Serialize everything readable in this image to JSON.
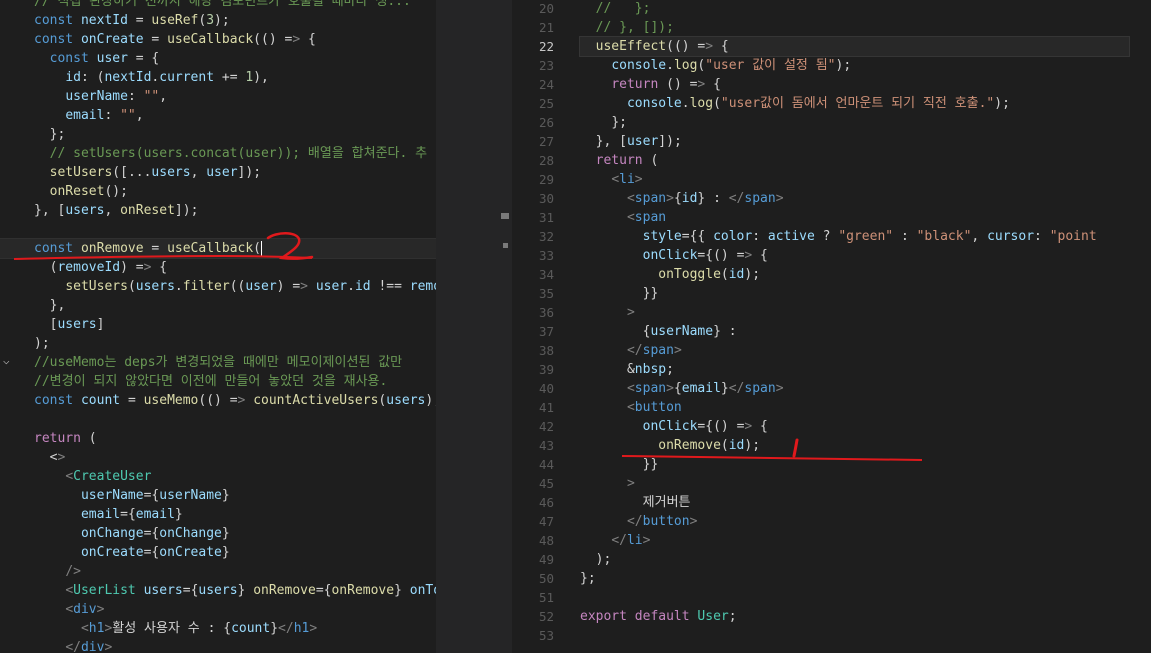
{
  "left_editor": {
    "lines": [
      "// 직접 관장하기 전까지 해당 컴포넌트가 호출될 때마다 생...",
      "const nextId = useRef(3);",
      "const onCreate = useCallback(() => {",
      "  const user = {",
      "    id: (nextId.current += 1),",
      "    userName: \"\",",
      "    email: \"\",",
      "  };",
      "  // setUsers(users.concat(user)); 배열을 합쳐준다. 추",
      "  setUsers([...users, user]);",
      "  onReset();",
      "}, [users, onReset]);",
      "",
      "const onRemove = useCallback(",
      "  (removeId) => {",
      "    setUsers(users.filter((user) => user.id !== remov",
      "  },",
      "  [users]",
      ");",
      "//useMemo는 deps가 변경되었을 때에만 메모이제이션된 값만",
      "//변경이 되지 않았다면 이전에 만들어 놓았던 것을 재사용.",
      "const count = useMemo(() => countActiveUsers(users),",
      "",
      "return (",
      "  <>",
      "    <CreateUser",
      "      userName={userName}",
      "      email={email}",
      "      onChange={onChange}",
      "      onCreate={onCreate}",
      "    />",
      "    <UserList users={users} onRemove={onRemove} onTo",
      "    <div>",
      "      <h1>활성 사용자 수 : {count}</h1>",
      "    </div>"
    ]
  },
  "right_editor": {
    "line_numbers": [
      "20",
      "21",
      "22",
      "23",
      "24",
      "25",
      "26",
      "27",
      "28",
      "29",
      "30",
      "31",
      "32",
      "33",
      "34",
      "35",
      "36",
      "37",
      "38",
      "39",
      "40",
      "41",
      "42",
      "43",
      "44",
      "45",
      "46",
      "47",
      "48",
      "49",
      "50",
      "51",
      "52",
      "53"
    ],
    "active_line": "22",
    "lines": [
      "  //   };",
      "  // }, []);",
      "  useEffect(() => {",
      "    console.log(\"user 값이 설정 됨\");",
      "    return () => {",
      "      console.log(\"user값이 돔에서 언마운트 되기 직전 호출.\");",
      "    };",
      "  }, [user]);",
      "  return (",
      "    <li>",
      "      <span>{id} : </span>",
      "      <span",
      "        style={{ color: active ? \"green\" : \"black\", cursor: \"point",
      "        onClick={() => {",
      "          onToggle(id);",
      "        }}",
      "      >",
      "        {userName} :",
      "      </span>",
      "      &nbsp;",
      "      <span>{email}</span>",
      "      <button",
      "        onClick={() => {",
      "          onRemove(id);",
      "        }}",
      "      >",
      "        제거버튼",
      "      </button>",
      "    </li>",
      "  );",
      "};",
      "",
      "export default User;",
      ""
    ]
  },
  "annotations": {
    "left_mark": "2",
    "right_mark": "1",
    "ink_color": "#e0191c"
  }
}
